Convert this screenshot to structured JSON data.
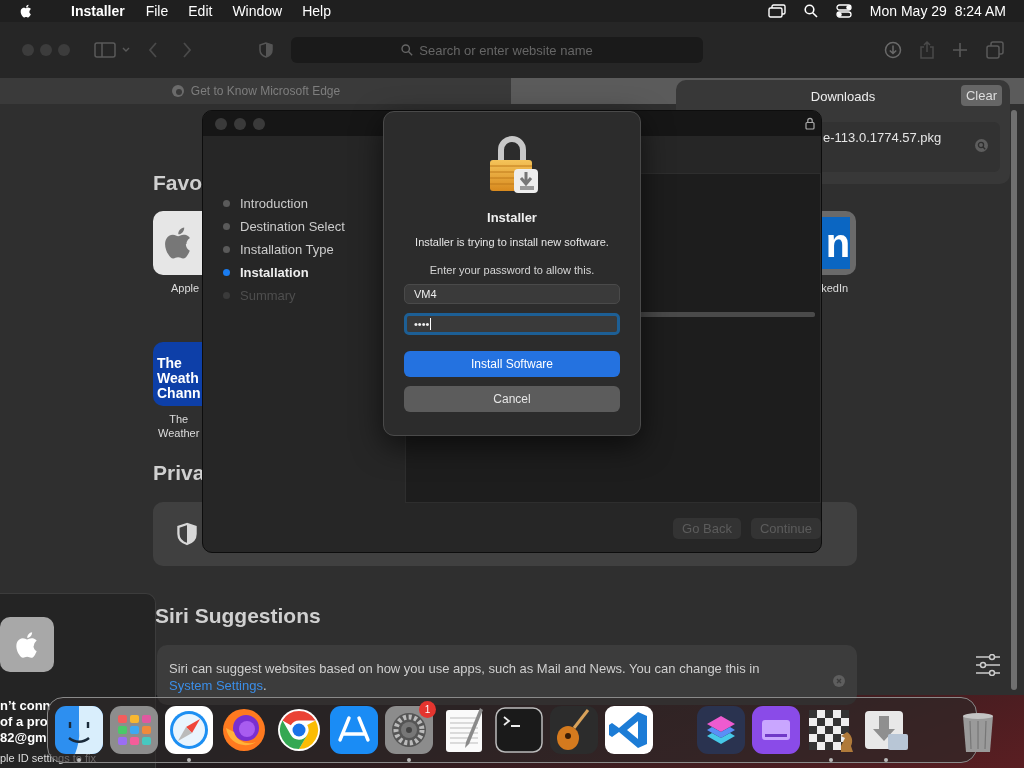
{
  "menu_bar": {
    "app_name": "Installer",
    "menus": [
      "File",
      "Edit",
      "Window",
      "Help"
    ],
    "clock": "Mon May 29  8:24 AM"
  },
  "browser": {
    "address_placeholder": "Search or enter website name",
    "tab_title": "Get to Know Microsoft Edge"
  },
  "start_page": {
    "favorites_heading": "Favo",
    "favorites": [
      {
        "kind": "apple",
        "label": "Apple"
      },
      {
        "kind": "linkedin",
        "label": "kedIn",
        "tile_lines": [
          "n"
        ]
      },
      {
        "kind": "weather",
        "label_lines": [
          "The",
          "Weather"
        ],
        "tile_lines": [
          "The",
          "Weath",
          "Chann"
        ]
      }
    ],
    "privacy_heading": "Priva",
    "siri_heading": "Siri Suggestions",
    "siri": {
      "text": "Siri can suggest websites based on how you use apps, such as Mail and News. You can change this in",
      "link": "System Settings",
      "text_after": "."
    }
  },
  "downloads": {
    "title": "Downloads",
    "clear_label": "Clear",
    "items": [
      {
        "file_name": "e-113.0.1774.57.pkg"
      }
    ]
  },
  "installer": {
    "steps": [
      {
        "label": "Introduction",
        "selected": false,
        "disabled": false
      },
      {
        "label": "Destination Select",
        "selected": false,
        "disabled": false
      },
      {
        "label": "Installation Type",
        "selected": false,
        "disabled": false
      },
      {
        "label": "Installation",
        "selected": true,
        "disabled": false
      },
      {
        "label": "Summary",
        "selected": false,
        "disabled": true
      }
    ],
    "progress": {
      "level": 1
    },
    "buttons": [
      {
        "label": "Go Back",
        "disabled": true
      },
      {
        "label": "Continue",
        "disabled": true
      }
    ]
  },
  "auth_dialog": {
    "title": "Installer",
    "message": "Installer is trying to install new software.",
    "prompt": "Enter your password to allow this.",
    "username": "VM4",
    "password": "••••",
    "password_focused": true,
    "primary_button": "Install Software",
    "cancel_button": "Cancel"
  },
  "notification": {
    "lines": [
      "n’t conn",
      "of a pro",
      "82@gm"
    ],
    "footer": "ple ID settings to fix"
  },
  "dock": {
    "items": [
      {
        "kind": "finder",
        "running": true
      },
      {
        "kind": "launchpad",
        "running": false
      },
      {
        "kind": "safari",
        "running": true
      },
      {
        "kind": "firefox",
        "running": false
      },
      {
        "kind": "chrome",
        "running": false
      },
      {
        "kind": "appstore",
        "running": false
      },
      {
        "kind": "settings",
        "running": true,
        "badge": "1"
      },
      {
        "kind": "textedit",
        "running": false
      },
      {
        "kind": "terminal",
        "running": false
      },
      {
        "kind": "garageband",
        "running": false
      },
      {
        "kind": "vscode",
        "running": false
      },
      {
        "kind": "separator"
      },
      {
        "kind": "shortcuts",
        "running": false
      },
      {
        "kind": "drive",
        "running": false
      },
      {
        "kind": "chess",
        "running": true
      },
      {
        "kind": "installer",
        "running": true
      },
      {
        "kind": "separator"
      },
      {
        "kind": "trash",
        "running": false
      }
    ]
  }
}
